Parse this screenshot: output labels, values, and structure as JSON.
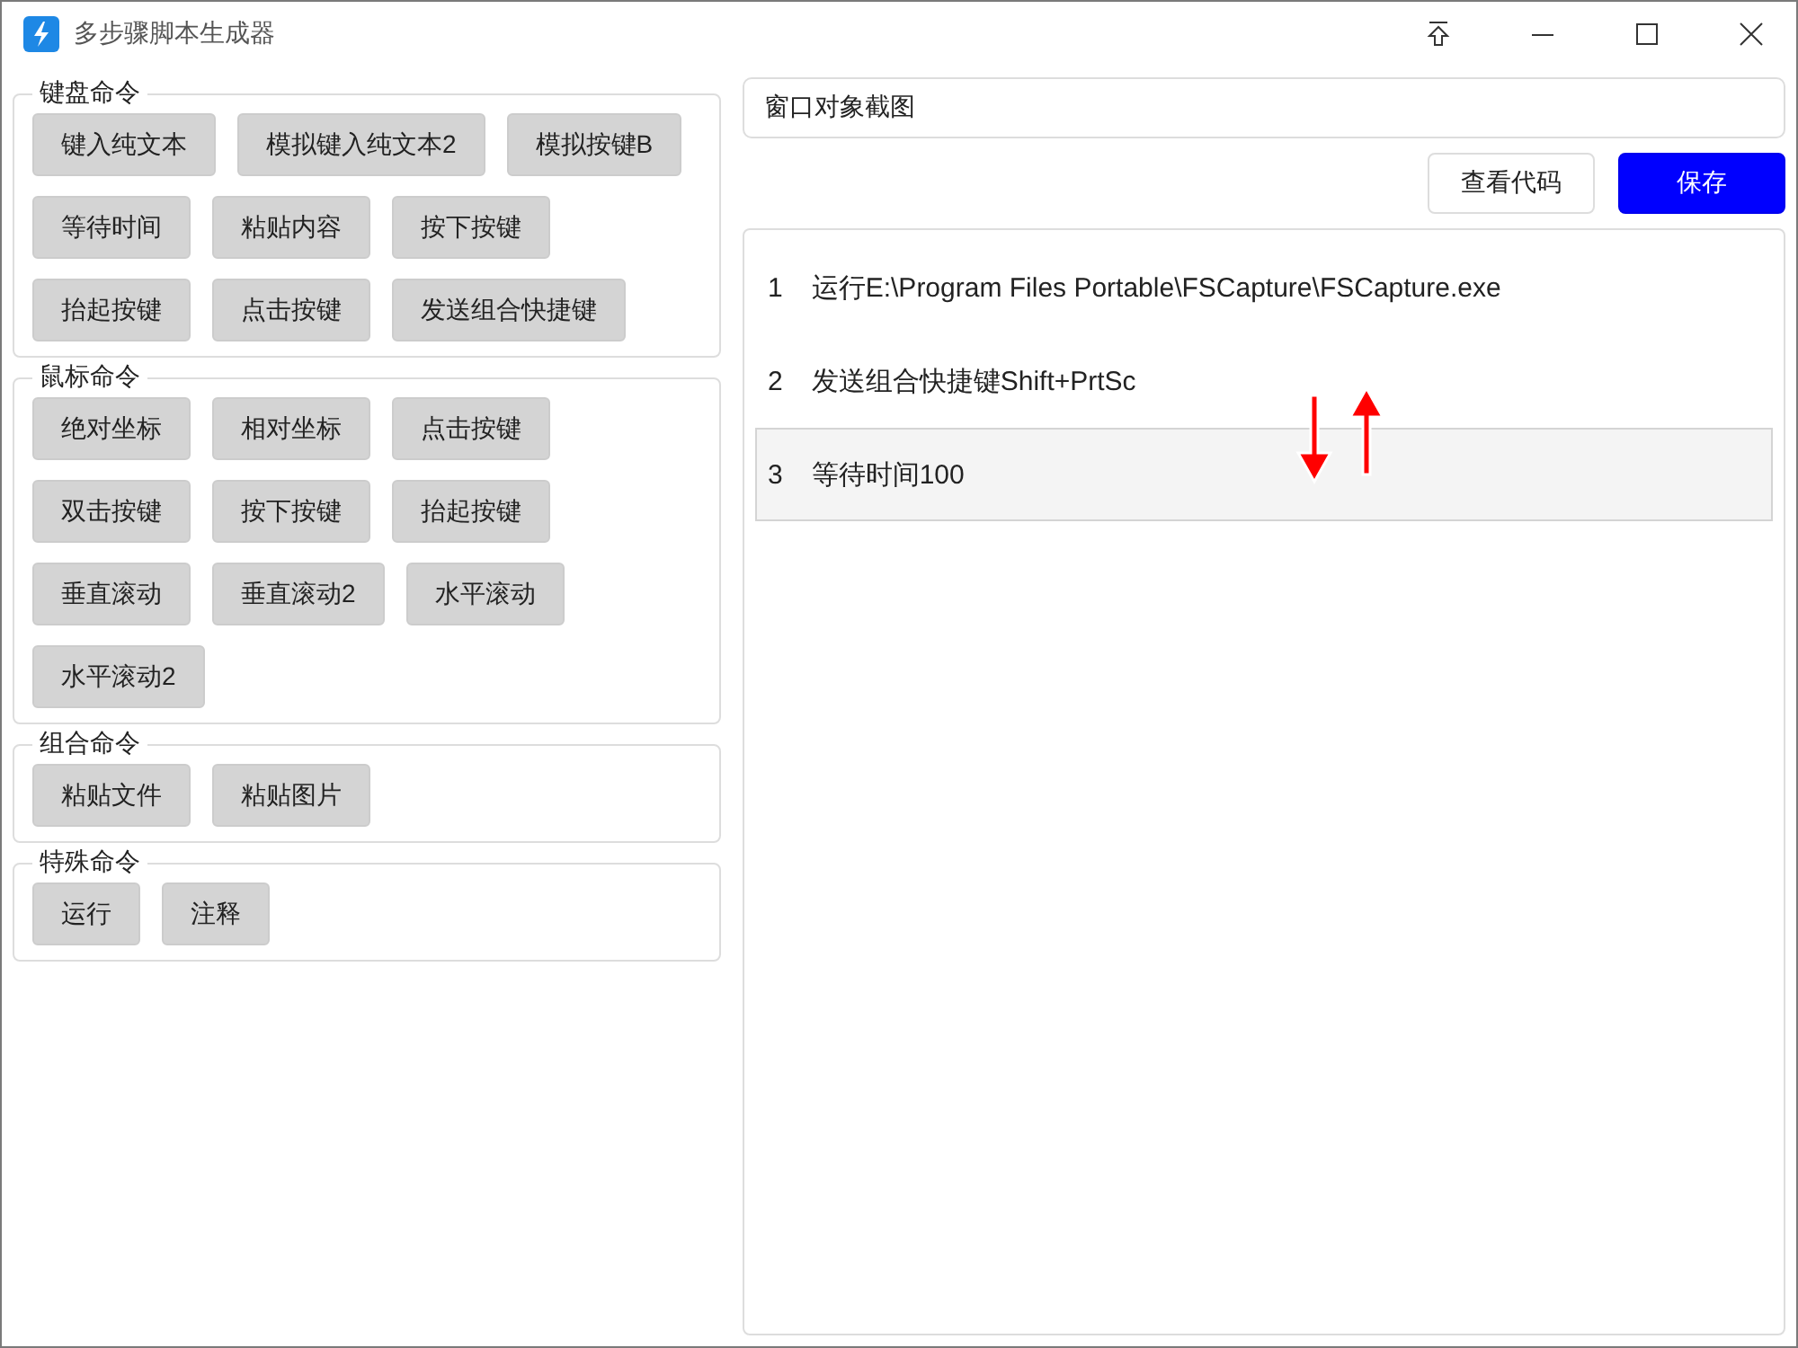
{
  "window": {
    "title": "多步骤脚本生成器"
  },
  "groups": [
    {
      "title": "键盘命令",
      "buttons": [
        "键入纯文本",
        "模拟键入纯文本2",
        "模拟按键B",
        "等待时间",
        "粘贴内容",
        "按下按键",
        "抬起按键",
        "点击按键",
        "发送组合快捷键"
      ]
    },
    {
      "title": "鼠标命令",
      "buttons": [
        "绝对坐标",
        "相对坐标",
        "点击按键",
        "双击按键",
        "按下按键",
        "抬起按键",
        "垂直滚动",
        "垂直滚动2",
        "水平滚动",
        "水平滚动2"
      ]
    },
    {
      "title": "组合命令",
      "buttons": [
        "粘贴文件",
        "粘贴图片"
      ]
    },
    {
      "title": "特殊命令",
      "buttons": [
        "运行",
        "注释"
      ]
    }
  ],
  "script_name": {
    "value": "窗口对象截图"
  },
  "actions": [
    {
      "label": "查看代码",
      "kind": "default"
    },
    {
      "label": "保存",
      "kind": "primary"
    }
  ],
  "steps": [
    {
      "number": "1",
      "text": "运行E:\\Program Files Portable\\FSCapture\\FSCapture.exe",
      "selected": false
    },
    {
      "number": "2",
      "text": "发送组合快捷键Shift+PrtSc",
      "selected": false
    },
    {
      "number": "3",
      "text": "等待时间100",
      "selected": true
    }
  ]
}
